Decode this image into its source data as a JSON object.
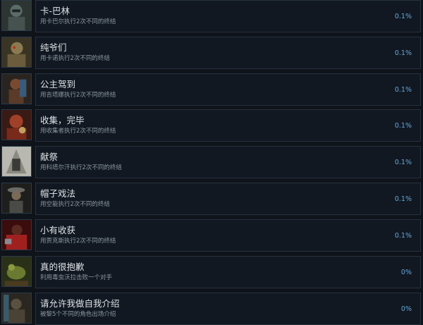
{
  "achievements": [
    {
      "title": "卡-巴林",
      "description": "用卡巴尔执行2次不同的终结",
      "percent": "0.1%",
      "icon": "kabal-portrait-icon",
      "color": "#5a6b68"
    },
    {
      "title": "纯爷们",
      "description": "用卡诺执行2次不同的终结",
      "percent": "0.1%",
      "icon": "kano-portrait-icon",
      "color": "#8a7a50"
    },
    {
      "title": "公主驾到",
      "description": "用吉塔娜执行2次不同的终结",
      "percent": "0.1%",
      "icon": "kitana-portrait-icon",
      "color": "#7a4a30"
    },
    {
      "title": "收集，完毕",
      "description": "用收集者执行2次不同的终结",
      "percent": "0.1%",
      "icon": "collector-portrait-icon",
      "color": "#a04028"
    },
    {
      "title": "献祭",
      "description": "用科塔尔汗执行2次不同的终结",
      "percent": "0.1%",
      "icon": "kotal-kahn-portrait-icon",
      "color": "#8a8a80"
    },
    {
      "title": "帽子戏法",
      "description": "用空能执行2次不同的终结",
      "percent": "0.1%",
      "icon": "kung-lao-portrait-icon",
      "color": "#4a4a46"
    },
    {
      "title": "小有收获",
      "description": "用贾克斯执行2次不同的终结",
      "percent": "0.1%",
      "icon": "jax-portrait-icon",
      "color": "#a02020"
    },
    {
      "title": "真的很抱歉",
      "description": "利用毒虫沃拉击败一个对手",
      "percent": "0%",
      "icon": "bug-brutality-icon",
      "color": "#6a7a30"
    },
    {
      "title": "请允许我做自我介绍",
      "description": "被黎5个不同的角色出场介绍",
      "percent": "0%",
      "icon": "intro-portrait-icon",
      "color": "#5a5040"
    }
  ]
}
